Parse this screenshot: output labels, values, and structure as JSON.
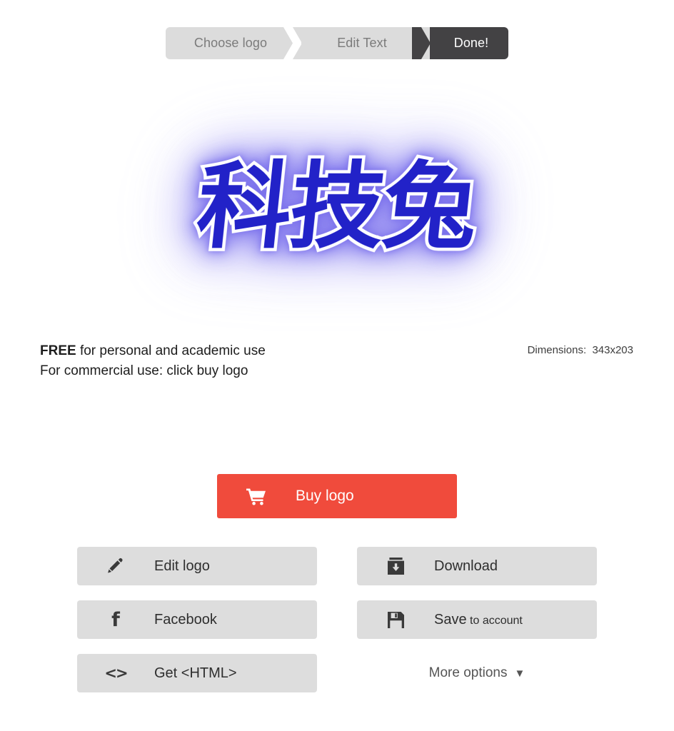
{
  "steps": [
    {
      "label": "Choose logo",
      "state": "done"
    },
    {
      "label": "Edit Text",
      "state": "done"
    },
    {
      "label": "Done!",
      "state": "active"
    }
  ],
  "logo": {
    "text": "科技兔",
    "fill_color": "#2222c8",
    "outline_color": "#ffffff",
    "glow_color": "#786beb"
  },
  "licence": {
    "line1_strong": "FREE",
    "line1_rest": " for personal and academic use",
    "line2": "For commercial use: click buy logo"
  },
  "dimensions": {
    "label": "Dimensions:",
    "value": "343x203",
    "full": "Dimensions:  343x203"
  },
  "buy": {
    "label": "Buy logo",
    "icon": "shopping-cart-icon",
    "color": "#f04b3c"
  },
  "options": [
    {
      "key": "edit",
      "label": "Edit logo",
      "icon": "pencil-icon"
    },
    {
      "key": "download",
      "label": "Download",
      "icon": "download-inbox-icon"
    },
    {
      "key": "facebook",
      "label": "Facebook",
      "icon": "facebook-f-icon"
    },
    {
      "key": "save",
      "label": "Save",
      "label_small": " to account",
      "icon": "floppy-disk-icon"
    },
    {
      "key": "html",
      "label": "Get <HTML>",
      "icon": "code-brackets-icon"
    }
  ],
  "more_options": {
    "label": "More options",
    "caret": "▼"
  }
}
